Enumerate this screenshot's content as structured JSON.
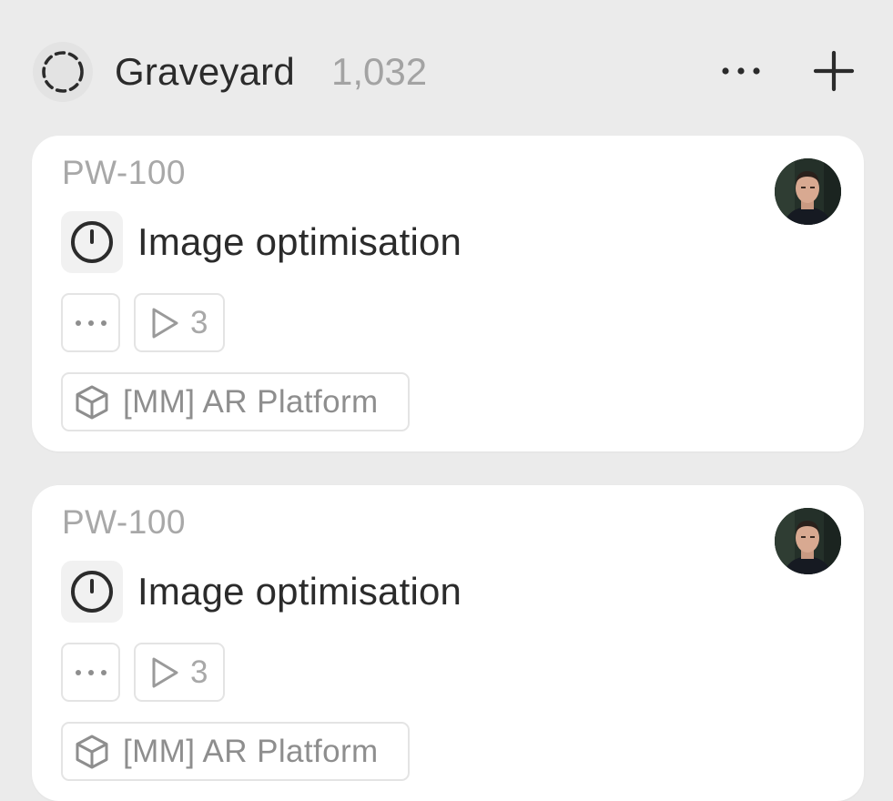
{
  "column": {
    "title": "Graveyard",
    "count": "1,032",
    "status_icon": "dashed-circle-icon",
    "more_icon": "more-horizontal-icon",
    "add_icon": "plus-icon"
  },
  "cards": [
    {
      "id": "PW-100",
      "title": "Image optimisation",
      "title_icon": "clock-icon",
      "avatar": "user-avatar",
      "more_icon": "more-horizontal-icon",
      "cycle_icon": "play-icon",
      "cycle_count": "3",
      "project_icon": "cube-icon",
      "project": "[MM] AR Platform"
    },
    {
      "id": "PW-100",
      "title": "Image optimisation",
      "title_icon": "clock-icon",
      "avatar": "user-avatar",
      "more_icon": "more-horizontal-icon",
      "cycle_icon": "play-icon",
      "cycle_count": "3",
      "project_icon": "cube-icon",
      "project": "[MM] AR Platform"
    }
  ],
  "colors": {
    "background": "#ebebeb",
    "card": "#ffffff",
    "text_primary": "#2b2b2b",
    "text_muted": "#a8a8a8",
    "chip_border": "#e4e4e4"
  }
}
